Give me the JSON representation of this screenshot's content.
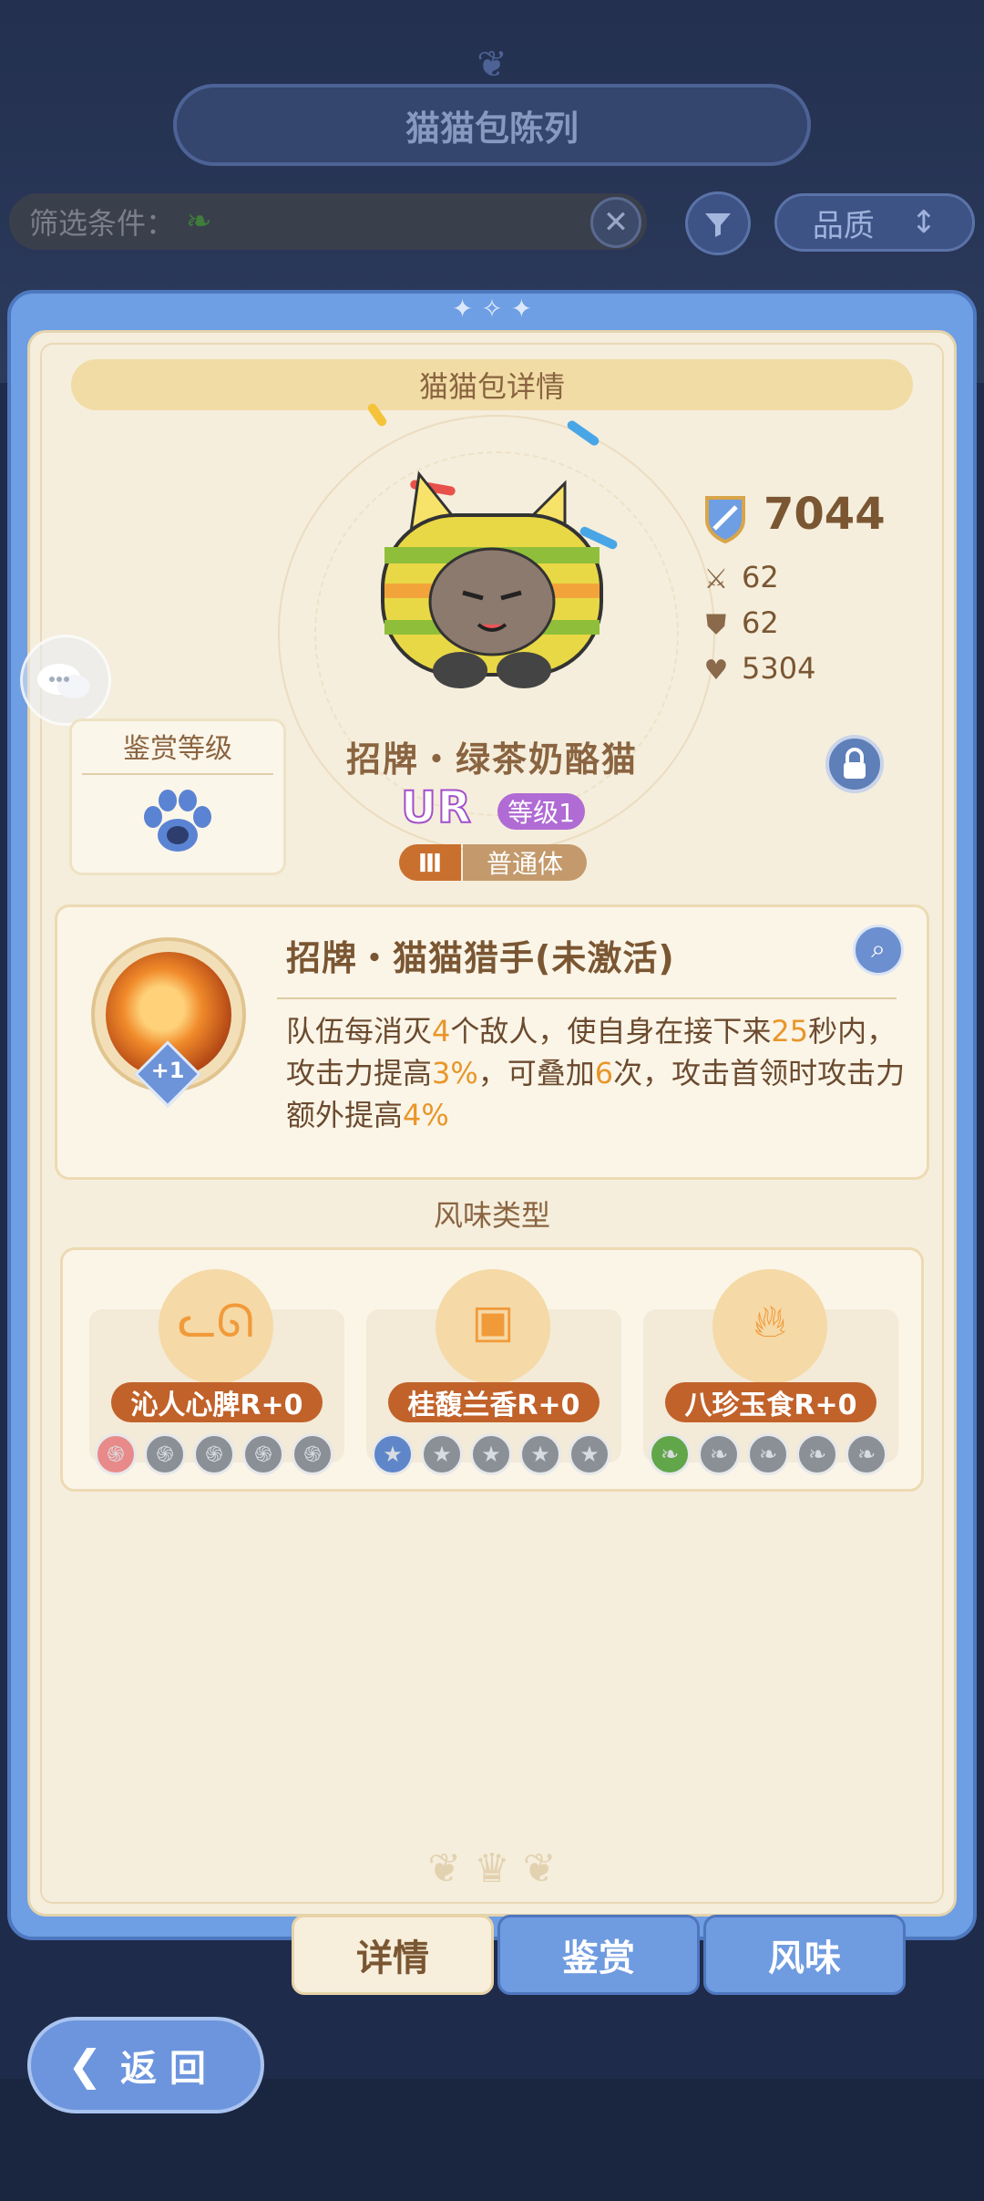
{
  "header": {
    "title": "猫猫包陈列"
  },
  "filter": {
    "label": "筛选条件：",
    "clear_icon": "close-icon",
    "funnel_icon": "funnel-icon",
    "quality_label": "品质"
  },
  "detail": {
    "header": "猫猫包详情",
    "power": "7044",
    "attack": "62",
    "defense": "62",
    "hp": "5304",
    "appraise_title": "鉴赏等级",
    "name": "招牌・绿茶奶酪猫",
    "rarity": "UR",
    "level": "等级1",
    "tier": "Ⅲ",
    "body_type": "普通体"
  },
  "skill": {
    "title": "招牌・猫猫猎手(未激活)",
    "plus": "+1",
    "desc_parts": [
      "队伍每消灭",
      "4",
      "个敌人，使自身在接下来",
      "25",
      "秒内，攻击力提高",
      "3%",
      "，可叠加",
      "6",
      "次，攻击首领时攻击力额外提高",
      "4%"
    ]
  },
  "flavor": {
    "heading": "风味类型",
    "items": [
      {
        "label": "沁人心脾R+0",
        "icon": "cat-face-icon",
        "slot_icon": "swirl-icon",
        "slot_color": "#e98a8a"
      },
      {
        "label": "桂馥兰香R+0",
        "icon": "square-icon",
        "slot_icon": "star-icon",
        "slot_color": "#5f86c9"
      },
      {
        "label": "八珍玉食R+0",
        "icon": "flame-icon",
        "slot_icon": "leaf-icon",
        "slot_color": "#62a64a"
      }
    ]
  },
  "tabs": [
    {
      "label": "详情",
      "active": true
    },
    {
      "label": "鉴赏",
      "active": false
    },
    {
      "label": "风味",
      "active": false
    }
  ],
  "back": {
    "label": "返 回"
  }
}
